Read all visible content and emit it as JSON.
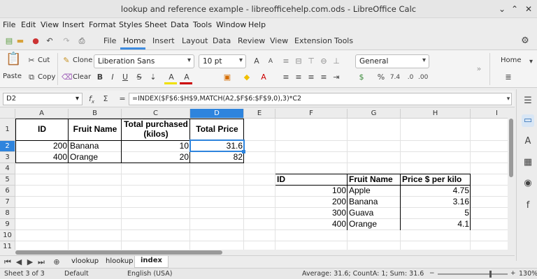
{
  "window": {
    "title": "lookup and reference example - libreofficehelp.com.ods - LibreOffice Calc"
  },
  "menubar": [
    "File",
    "Edit",
    "View",
    "Insert",
    "Format",
    "Styles",
    "Sheet",
    "Data",
    "Tools",
    "Window",
    "Help"
  ],
  "tabs": [
    "File",
    "Home",
    "Insert",
    "Layout",
    "Data",
    "Review",
    "View",
    "Extension",
    "Tools"
  ],
  "ribbon": {
    "paste": "Paste",
    "cut": "Cut",
    "copy": "Copy",
    "clone": "Clone",
    "clear": "Clear",
    "font": "Liberation Sans",
    "size": "10 pt",
    "number_format": "General",
    "right_home": "Home",
    "percent": "%",
    "decimals": "7.4",
    "bold": "B",
    "italic": "I",
    "underline": "U",
    "strike": "S"
  },
  "formula_bar": {
    "name_box": "D2",
    "fx": "f",
    "formula": "=INDEX($F$6:$H$9,MATCH(A2,$F$6:$F$9,0),3)*C2"
  },
  "grid": {
    "columns": [
      "A",
      "B",
      "C",
      "D",
      "E",
      "F",
      "G",
      "H",
      "I"
    ],
    "rows": [
      "1",
      "2",
      "3",
      "4",
      "5",
      "6",
      "7",
      "8",
      "9",
      "10",
      "11"
    ],
    "headers1": {
      "a": "ID",
      "b": "Fruit Name",
      "c1": "Total purchased",
      "c2": "(kilos)",
      "d": "Total Price"
    },
    "data1": [
      {
        "id": "200",
        "name": "Banana",
        "qty": "10",
        "price": "31.6"
      },
      {
        "id": "400",
        "name": "Orange",
        "qty": "20",
        "price": "82"
      }
    ],
    "headers2": {
      "f": "ID",
      "g": "Fruit Name",
      "h": "Price $ per kilo"
    },
    "data2": [
      {
        "id": "100",
        "name": "Apple",
        "price": "4.75"
      },
      {
        "id": "200",
        "name": "Banana",
        "price": "3.16"
      },
      {
        "id": "300",
        "name": "Guava",
        "price": "5"
      },
      {
        "id": "400",
        "name": "Orange",
        "price": "4.1"
      }
    ]
  },
  "sheets": [
    "vlookup",
    "hlookup",
    "index"
  ],
  "status": {
    "sheet": "Sheet 3 of 3",
    "style": "Default",
    "lang": "English (USA)",
    "summary": "Average: 31.6; CountA: 1; Sum: 31.6",
    "zoom": "130%"
  }
}
